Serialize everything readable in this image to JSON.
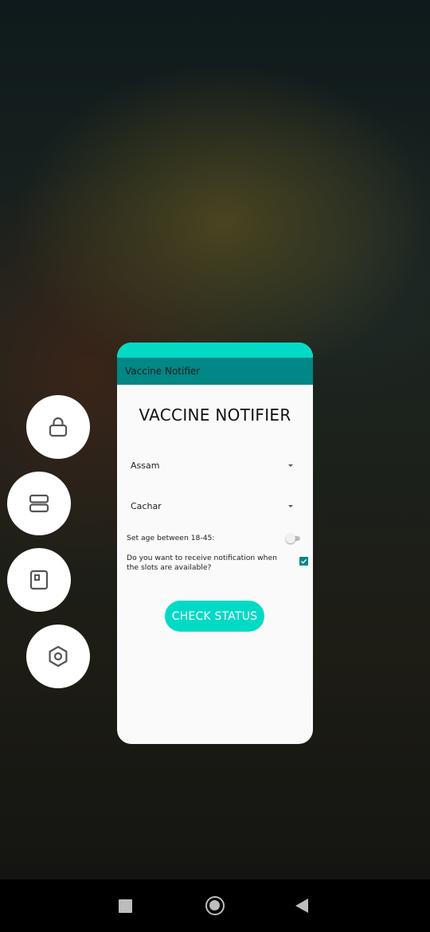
{
  "side_actions": [
    {
      "icon": "lock-icon"
    },
    {
      "icon": "split-screen-icon"
    },
    {
      "icon": "small-window-icon"
    },
    {
      "icon": "app-settings-icon"
    }
  ],
  "app": {
    "toolbar_title": "Vaccine Notifier",
    "heading": "VACCINE NOTIFIER",
    "state_spinner": {
      "selected": "Assam"
    },
    "district_spinner": {
      "selected": "Cachar"
    },
    "age_toggle": {
      "label": "Set age between 18-45:",
      "checked": false
    },
    "notify_checkbox": {
      "label": "Do you want to receive notification when the slots are available?",
      "checked": true
    },
    "check_button_label": "CHECK STATUS"
  },
  "colors": {
    "accent": "#03dac5",
    "primary_dark": "#018786"
  },
  "navbar": {
    "items": [
      "recents-icon",
      "home-icon",
      "back-icon"
    ]
  }
}
